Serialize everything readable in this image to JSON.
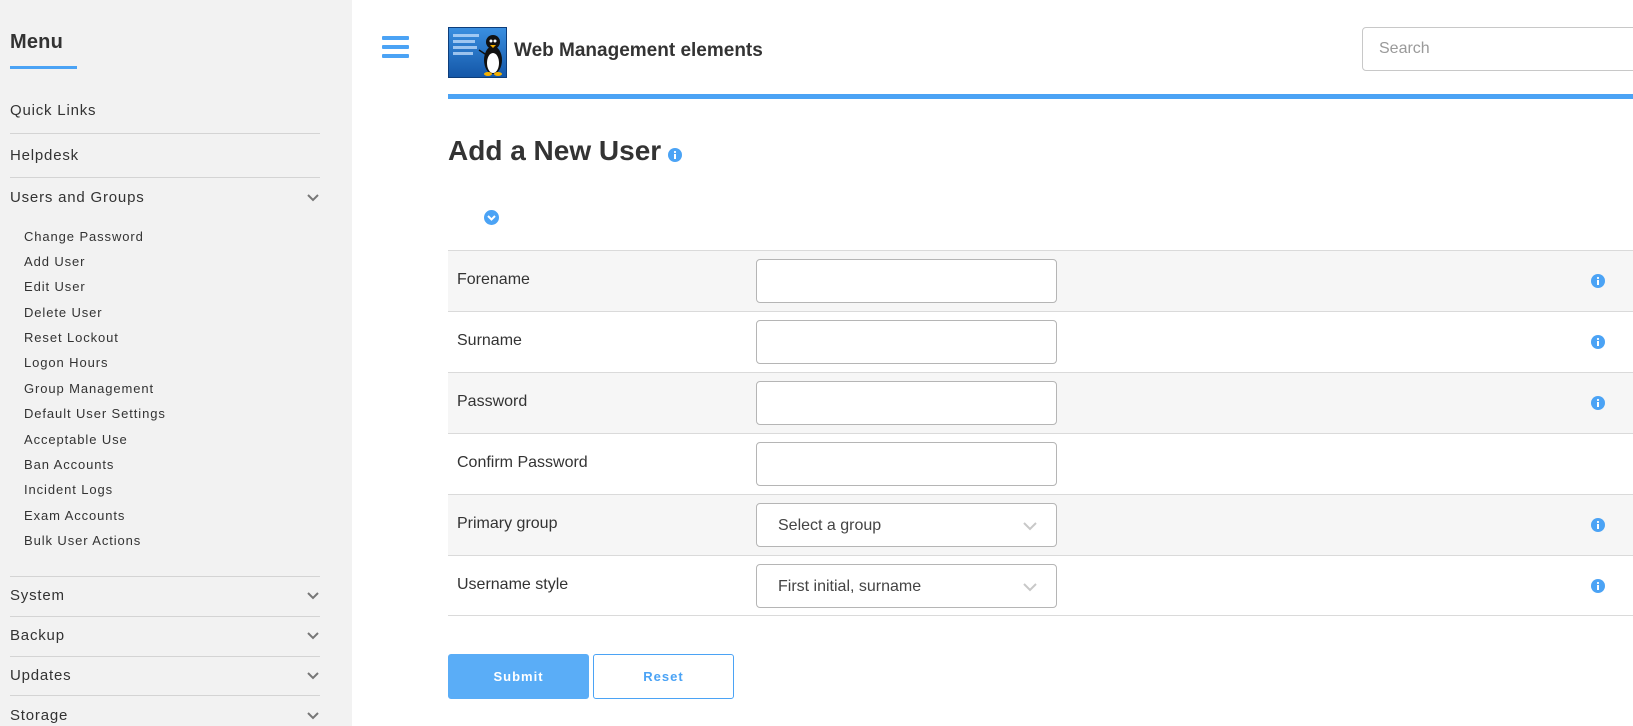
{
  "sidebar": {
    "title": "Menu",
    "items": [
      {
        "label": "Quick Links"
      },
      {
        "label": "Helpdesk"
      },
      {
        "label": "Users and Groups"
      },
      {
        "label": "System"
      },
      {
        "label": "Backup"
      },
      {
        "label": "Updates"
      },
      {
        "label": "Storage"
      }
    ],
    "subitems": [
      {
        "label": "Change Password"
      },
      {
        "label": "Add User"
      },
      {
        "label": "Edit User"
      },
      {
        "label": "Delete User"
      },
      {
        "label": "Reset Lockout"
      },
      {
        "label": "Logon Hours"
      },
      {
        "label": "Group Management"
      },
      {
        "label": "Default User Settings"
      },
      {
        "label": "Acceptable Use"
      },
      {
        "label": "Ban Accounts"
      },
      {
        "label": "Incident Logs"
      },
      {
        "label": "Exam Accounts"
      },
      {
        "label": "Bulk User Actions"
      }
    ]
  },
  "header": {
    "app_title": "Web Management elements",
    "search_placeholder": "Search"
  },
  "page": {
    "title": "Add a New User"
  },
  "form": {
    "rows": [
      {
        "label": "Forename",
        "value": ""
      },
      {
        "label": "Surname",
        "value": ""
      },
      {
        "label": "Password",
        "value": ""
      },
      {
        "label": "Confirm Password",
        "value": ""
      },
      {
        "label": "Primary group",
        "value": "Select a group"
      },
      {
        "label": "Username style",
        "value": "First initial, surname"
      }
    ],
    "submit_label": "Submit",
    "reset_label": "Reset"
  },
  "colors": {
    "accent": "#4ba3f5",
    "sidebar_bg": "#f2f2f2"
  }
}
